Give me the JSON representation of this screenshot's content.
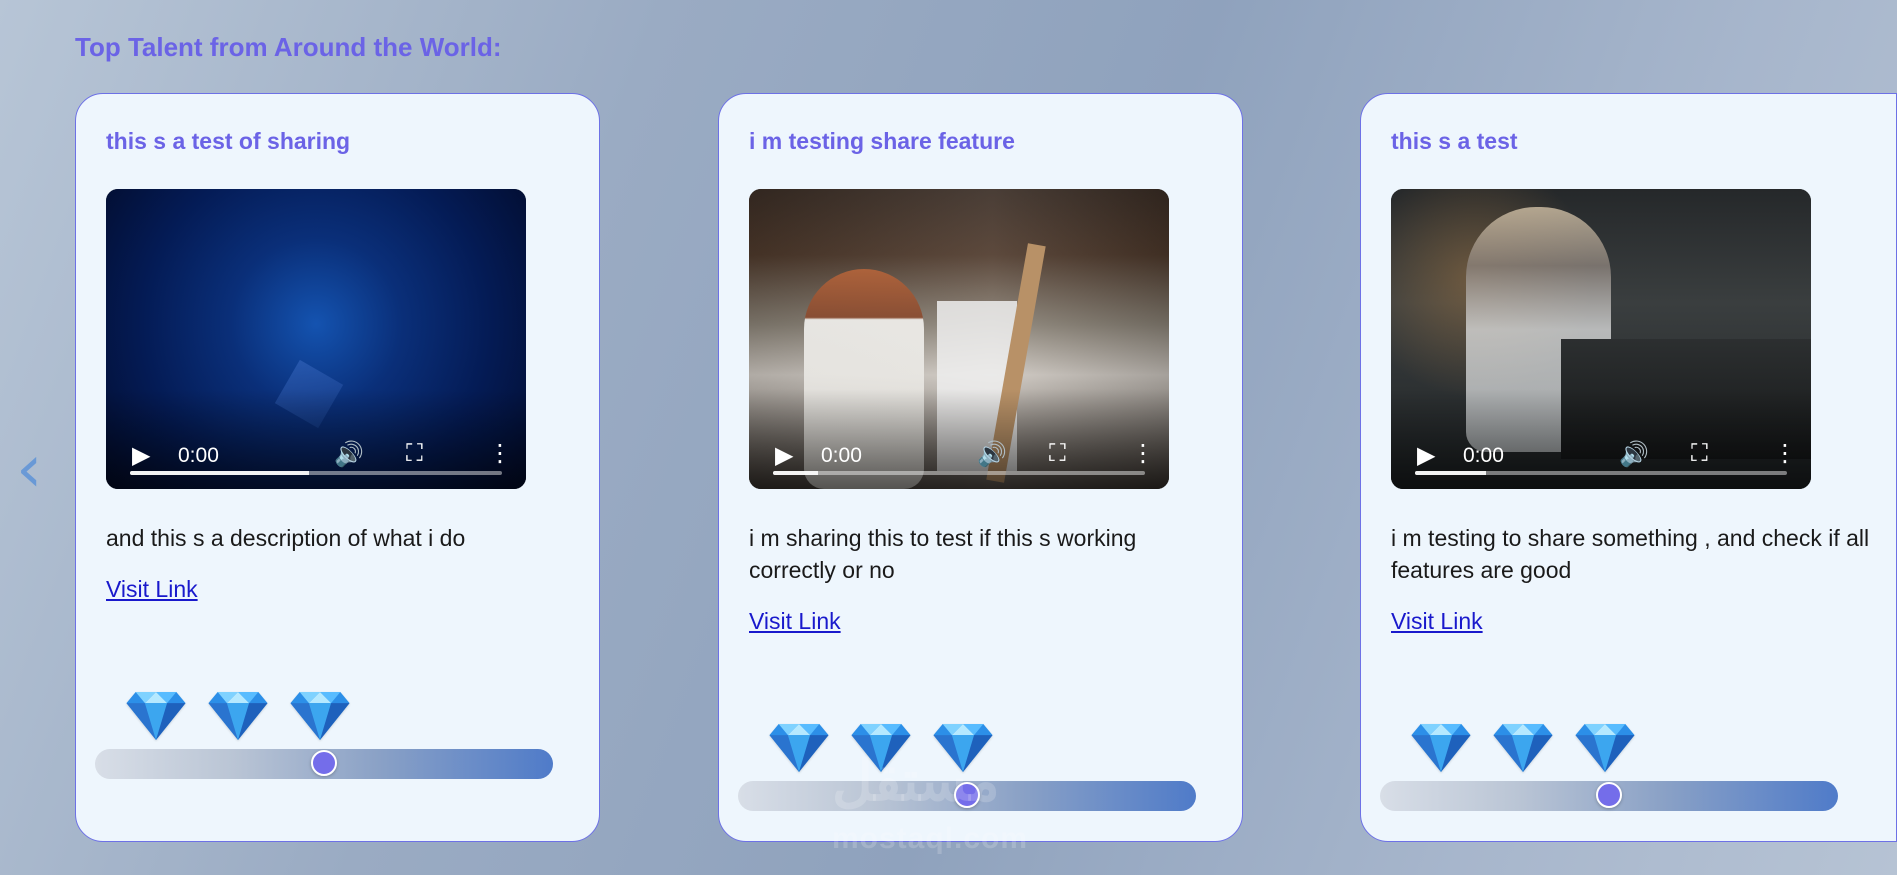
{
  "page": {
    "title": "Top Talent from Around the World:"
  },
  "watermark": {
    "arabic": "مستقل",
    "latin": "mostaql.com"
  },
  "navigation": {
    "prev_icon": "chevron-left-icon",
    "next_icon": "chevron-right-icon"
  },
  "cards": [
    {
      "title": "this s a test of sharing",
      "video": {
        "time": "0:00",
        "progress": 0.48
      },
      "description": "and this s a description of what i do",
      "link_text": "Visit Link",
      "gems": [
        "diamond-icon",
        "diamond-icon",
        "diamond-icon"
      ],
      "slider_value": 0.5
    },
    {
      "title": "i m testing share feature",
      "video": {
        "time": "0:00",
        "progress": 0.12
      },
      "description": "i m sharing this to test if this s working correctly or no",
      "link_text": "Visit Link",
      "gems": [
        "diamond-icon",
        "diamond-icon",
        "diamond-icon"
      ],
      "slider_value": 0.5
    },
    {
      "title": "this s a test",
      "video": {
        "time": "0:00",
        "progress": 0.19
      },
      "description": "i m testing to share something , and check if all features are good",
      "link_text": "Visit Link",
      "gems": [
        "diamond-icon",
        "diamond-icon",
        "diamond-icon"
      ],
      "slider_value": 0.5
    }
  ],
  "colors": {
    "accent": "#6B63E6",
    "link": "#1919CC",
    "card_background": "#EEF6FD",
    "card_border": "#6D71E6"
  }
}
